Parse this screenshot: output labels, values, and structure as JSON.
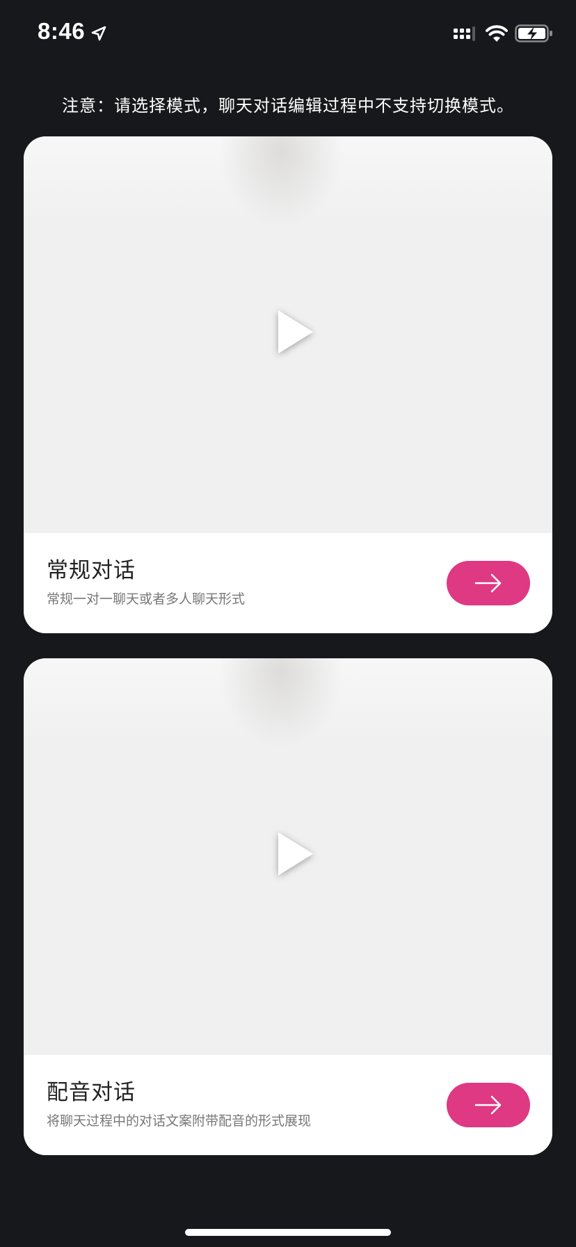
{
  "status_bar": {
    "time": "8:46",
    "icons": [
      "location-arrow-icon",
      "cellular-signal-icon",
      "wifi-icon",
      "battery-charging-icon"
    ]
  },
  "notice": "注意：请选择模式，聊天对话编辑过程中不支持切换模式。",
  "modes": [
    {
      "title": "常规对话",
      "description": "常规一对一聊天或者多人聊天形式",
      "preview_icon": "play-icon",
      "action_icon": "arrow-right-icon"
    },
    {
      "title": "配音对话",
      "description": "将聊天过程中的对话文案附带配音的形式展现",
      "preview_icon": "play-icon",
      "action_icon": "arrow-right-icon"
    }
  ],
  "colors": {
    "background": "#17181c",
    "accent": "#de3982",
    "card": "#ffffff",
    "video_placeholder": "#f0f0f0"
  }
}
